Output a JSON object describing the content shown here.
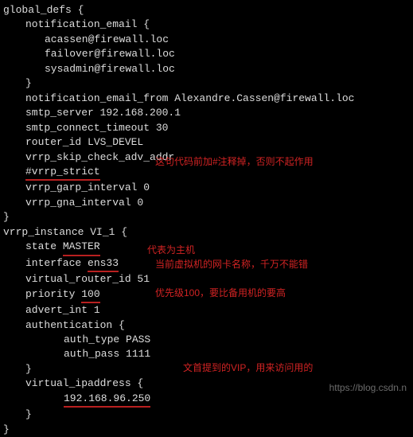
{
  "lines": {
    "l0": "global_defs {",
    "l1": "notification_email {",
    "l2": "acassen@firewall.loc",
    "l3": "failover@firewall.loc",
    "l4": "sysadmin@firewall.loc",
    "l5": "}",
    "l6": "notification_email_from Alexandre.Cassen@firewall.loc",
    "l7": "smtp_server 192.168.200.1",
    "l8": "smtp_connect_timeout 30",
    "l9": "router_id LVS_DEVEL",
    "l10": "vrrp_skip_check_adv_addr",
    "l11": "#vrrp_strict",
    "l12": "vrrp_garp_interval 0",
    "l13": "vrrp_gna_interval 0",
    "l14": "}",
    "l15": "",
    "l16": "vrrp_instance VI_1 {",
    "l17a": "state ",
    "l17b": "MASTER",
    "l18a": "interface ",
    "l18b": "ens33",
    "l19": "virtual_router_id 51",
    "l20a": "priority ",
    "l20b": "100",
    "l21": "advert_int 1",
    "l22": "authentication {",
    "l23": "auth_type PASS",
    "l24": "auth_pass 1111",
    "l25": "}",
    "l26": "virtual_ipaddress {",
    "l27": "192.168.96.250",
    "l28": "}",
    "l29": "}"
  },
  "notes": {
    "n1": "这句代码前加#注释掉，否则不起作用",
    "n2": "代表为主机",
    "n3": "当前虚拟机的网卡名称，千万不能错",
    "n4": "优先级100，要比备用机的要高",
    "n5": "文首提到的VIP，用来访问用的"
  },
  "watermark": "https://blog.csdn.n"
}
